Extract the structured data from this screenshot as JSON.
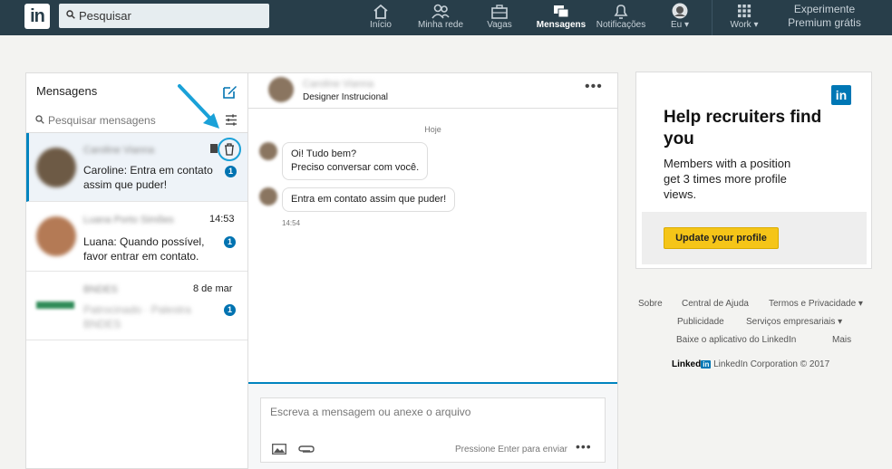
{
  "nav": {
    "logo": "in",
    "search_placeholder": "Pesquisar",
    "items": [
      {
        "label": "Início",
        "icon": "home-icon"
      },
      {
        "label": "Minha rede",
        "icon": "network-icon"
      },
      {
        "label": "Vagas",
        "icon": "briefcase-icon"
      },
      {
        "label": "Mensagens",
        "icon": "messaging-icon",
        "active": true
      },
      {
        "label": "Notificações",
        "icon": "bell-icon"
      },
      {
        "label": "Eu ▾",
        "icon": "profile-avatar"
      },
      {
        "label": "Work ▾",
        "icon": "grid-icon"
      }
    ],
    "premium_line1": "Experimente",
    "premium_line2": "Premium grátis"
  },
  "messages": {
    "title": "Mensagens",
    "search_placeholder": "Pesquisar mensagens",
    "conversations": [
      {
        "name": "Caroline Vianna",
        "preview": "Caroline: Entra em contato assim que puder!",
        "time": "",
        "unread": "1",
        "selected": true
      },
      {
        "name": "Luana Porto Simões",
        "preview": "Luana: Quando possível, favor entrar em contato.",
        "time": "14:53",
        "unread": "1"
      },
      {
        "name": "BNDES",
        "preview": "Patrocinado · Palestra BNDES",
        "time": "8 de mar",
        "unread": "1"
      }
    ]
  },
  "thread": {
    "contact_name": "Caroline Vianna",
    "contact_title": "Designer Instrucional",
    "day_label": "Hoje",
    "bubbles": [
      {
        "line1": "Oi! Tudo bem?",
        "line2": "Preciso conversar com você."
      },
      {
        "line1": "Entra em contato assim que puder!"
      }
    ],
    "timestamp": "14:54",
    "composer_placeholder": "Escreva a mensagem ou anexe o arquivo",
    "send_hint": "Pressione Enter para enviar"
  },
  "ad": {
    "logo": "in",
    "headline": "Help recruiters find you",
    "body": "Members with a position get 3 times more profile views.",
    "button": "Update your profile"
  },
  "footer": {
    "links": [
      "Sobre",
      "Central de Ajuda",
      "Termos e Privacidade ▾",
      "Publicidade",
      "Serviços empresariais ▾",
      "Baixe o aplicativo do LinkedIn",
      "Mais"
    ],
    "brand_word": "Linked",
    "brand_in": "in",
    "copyright": "LinkedIn Corporation © 2017"
  },
  "colors": {
    "nav_bg": "#283e4a",
    "accent": "#0084bf",
    "badge": "#0073b1",
    "annotation": "#1aa1d8",
    "ad_button": "#f5c518"
  }
}
